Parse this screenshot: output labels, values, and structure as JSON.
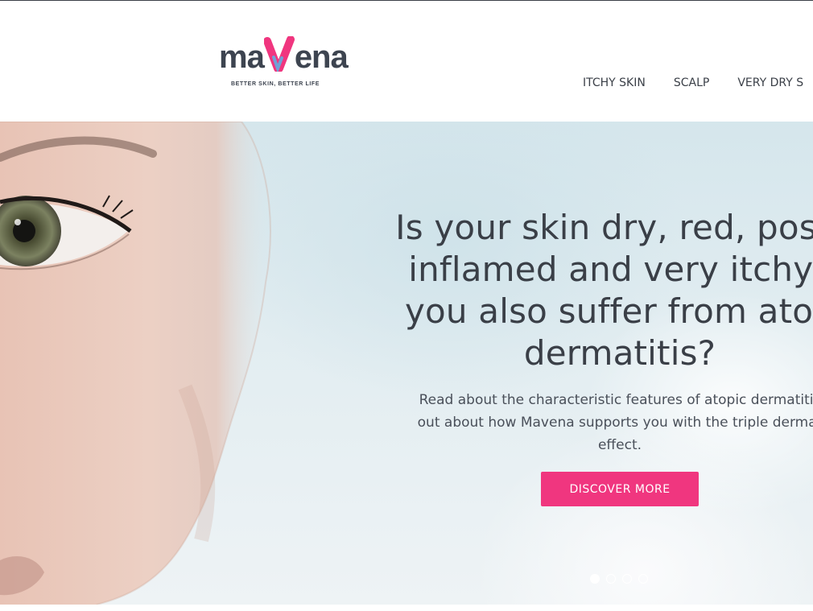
{
  "header": {
    "logo": {
      "prefix": "ma",
      "v_letter": "V",
      "suffix": "ena",
      "tagline": "BETTER SKIN, BETTER LIFE",
      "accent_pink": "#f0367f",
      "accent_blue": "#5ab4e6"
    },
    "nav": [
      {
        "label": "ITCHY SKIN"
      },
      {
        "label": "SCALP"
      },
      {
        "label": "VERY DRY S"
      }
    ]
  },
  "hero": {
    "title": "Is your skin dry, red, possi inflamed and very itchy? you also suffer from atop dermatitis?",
    "title_lines": [
      "Is your skin dry, red, possi",
      "inflamed and very itchy?",
      "you also suffer from atop",
      "dermatitis?"
    ],
    "text_lines": [
      "Read about the characteristic features of atopic dermatitis",
      "out about how Mavena supports you with the triple dermat",
      "effect."
    ],
    "cta_label": "DISCOVER MORE",
    "cta_color": "#f0367f",
    "slider": {
      "count": 4,
      "active_index": 0
    }
  }
}
